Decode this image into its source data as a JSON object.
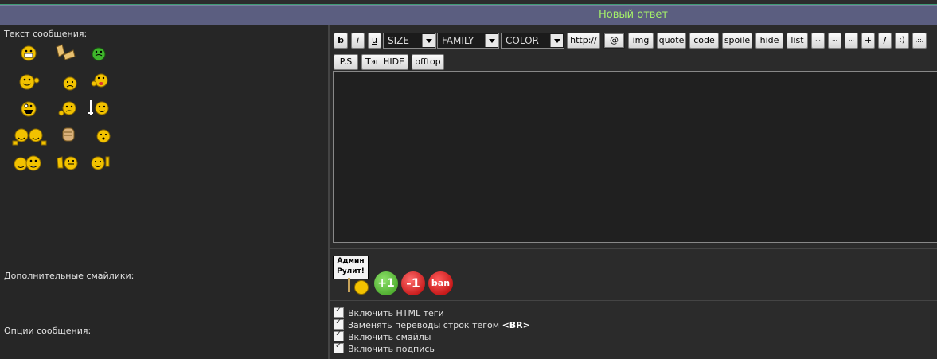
{
  "header": {
    "title": "Новый ответ"
  },
  "labels": {
    "message_text": "Текст сообщения:",
    "extra_smilies": "Дополнительные смайлики:",
    "message_options": "Опции сообщения:"
  },
  "smilies": [
    "grin-icon",
    "clap-hands-icon",
    "sick-green-icon",
    "waving-smiley-icon",
    "sad-smiley-icon",
    "tongue-smiley-icon",
    "crazy-smiley-icon",
    "thinking-smiley-icon",
    "sign-smiley-icon",
    "friends-hug-icon",
    "fist-icon",
    "worried-smiley-icon",
    "laughing-group-icon",
    "hand-smiley-icon",
    "thumbs-up-smiley-icon"
  ],
  "toolbar": {
    "b": "b",
    "i": "i",
    "u": "u",
    "size": "SIZE",
    "family": "FAMILY",
    "color": "COLOR",
    "http": "http://",
    "at": "@",
    "img": "img",
    "quote": "quote",
    "code": "code",
    "spoiler": "spoile",
    "hide": "hide",
    "list": "list",
    "dots1": "···",
    "dots2": "···",
    "dots3": "···",
    "plus": "+",
    "slash": "/",
    "smile": ":)",
    "dots4": ".::.",
    "ps": "P.S",
    "taghide": "Тэг HIDE",
    "offtop": "offtop"
  },
  "extra_smilies": {
    "sign_line1": "Админ",
    "sign_line2": "Рулит!",
    "plus_one": "+1",
    "minus_one": "-1",
    "ban": "ban"
  },
  "options": [
    {
      "label": "Включить HTML теги",
      "checked": true
    },
    {
      "label": "Заменять переводы строк тегом ",
      "suffix": "<BR>",
      "checked": true
    },
    {
      "label": "Включить смайлы",
      "checked": true
    },
    {
      "label": "Включить подпись",
      "checked": true
    }
  ],
  "colors": {
    "header_bg": "#5b5e80",
    "header_text": "#a4ef6a",
    "smile_yellow": "#f2c200"
  }
}
